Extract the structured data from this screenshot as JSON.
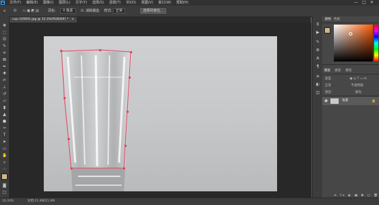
{
  "menubar": {
    "app_icon": "Ps",
    "items": [
      "文件(F)",
      "编辑(E)",
      "图像(I)",
      "图层(L)",
      "文字(Y)",
      "选择(S)",
      "滤镜(T)",
      "3D(D)",
      "视图(V)",
      "窗口(W)",
      "帮助(H)"
    ],
    "window_controls": [
      "—",
      "□",
      "✕"
    ]
  },
  "options": {
    "feather_label": "羽化:",
    "feather_value": "0 像素",
    "antialias_label": "消除锯齿",
    "style_label": "样式:",
    "style_value": "正常",
    "select_subject_label": "选择并遮住...",
    "tool_icon": "lasso-icon"
  },
  "document": {
    "tab_label": "cup-120601.jpg @ 33.3%(RGB/8#) *",
    "close": "×"
  },
  "status": {
    "zoom": "33.33%",
    "doc_info": "文档:21.4M/21.4M"
  },
  "panels": {
    "color_tabs": [
      "颜色",
      "色板"
    ],
    "layers_tabs": [
      "图层",
      "通道",
      "路径"
    ],
    "layer_kind_label": "类型",
    "blend_mode": "正常",
    "opacity_label": "不透明度:",
    "lock_label": "锁定:",
    "fill_label": "填充:",
    "layer_name": "背景"
  },
  "colors": {
    "foreground": "#d2b68f",
    "background": "#ffffff",
    "path_stroke": "#e0455f"
  }
}
